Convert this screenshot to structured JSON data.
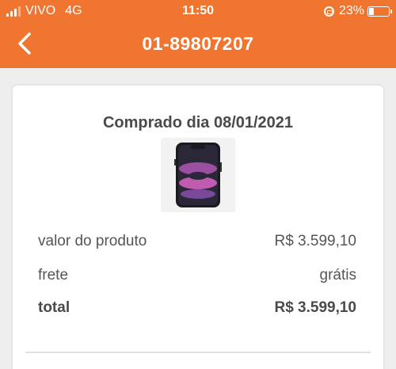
{
  "status_bar": {
    "carrier": "VIVO",
    "network": "4G",
    "time": "11:50",
    "battery": "23%"
  },
  "header": {
    "title": "01-89807207",
    "back_icon": "chevron-left-icon"
  },
  "order": {
    "purchase_date": "Comprado dia 08/01/2021",
    "product_image": "iphone-11-black",
    "rows": [
      {
        "label": "valor do produto",
        "value": "R$ 3.599,10"
      },
      {
        "label": "frete",
        "value": "grátis"
      },
      {
        "label": "total",
        "value": "R$ 3.599,10"
      }
    ]
  },
  "colors": {
    "header": "#ef7530",
    "background": "#eeeeee"
  }
}
